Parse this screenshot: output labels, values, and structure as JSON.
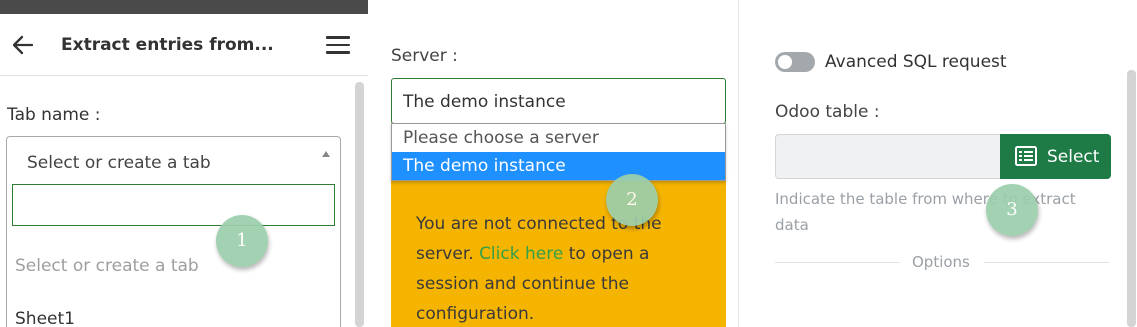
{
  "panel1": {
    "header_title": "Extract entries from...",
    "tab_name_label": "Tab name :",
    "select_placeholder": "Select or create a tab",
    "dropdown": {
      "search_value": "",
      "placeholder": "Select or create a tab",
      "options": [
        "Sheet1"
      ]
    }
  },
  "panel2": {
    "server_label": "Server :",
    "server_selected": "The demo instance",
    "dropdown_options": [
      "Please choose a server",
      "The demo instance"
    ],
    "warning": {
      "text_before": "You are not connected to the server. ",
      "link": "Click here",
      "text_after": " to open a session and continue the configuration."
    }
  },
  "panel3": {
    "advanced_toggle_label": "Avanced SQL request",
    "odoo_table_label": "Odoo table :",
    "table_value": "",
    "select_button": "Select",
    "hint": "Indicate the table from where to extract data",
    "options_divider": "Options"
  },
  "markers": [
    "1",
    "2",
    "3"
  ],
  "colors": {
    "accent_green": "#1e7b45",
    "warning_bg": "#f5b400",
    "highlight_blue": "#1e90ff",
    "marker": "#9ccfac"
  },
  "icons": [
    "back-arrow-icon",
    "hamburger-menu-icon",
    "dropdown-caret-icon",
    "table-list-icon"
  ]
}
